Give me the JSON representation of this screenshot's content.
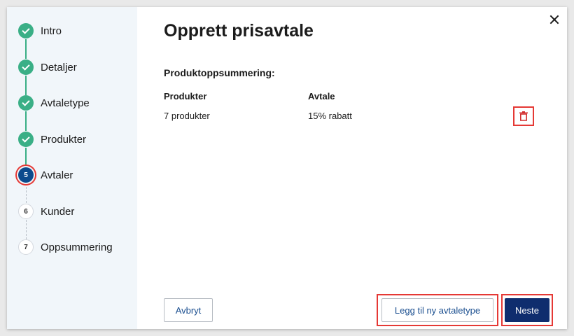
{
  "steps": [
    {
      "label": "Intro",
      "status": "done"
    },
    {
      "label": "Detaljer",
      "status": "done"
    },
    {
      "label": "Avtaletype",
      "status": "done"
    },
    {
      "label": "Produkter",
      "status": "done"
    },
    {
      "label": "Avtaler",
      "status": "active",
      "number": "5"
    },
    {
      "label": "Kunder",
      "status": "todo",
      "number": "6"
    },
    {
      "label": "Oppsummering",
      "status": "todo",
      "number": "7"
    }
  ],
  "dialog": {
    "title": "Opprett prisavtale",
    "section_title": "Produktoppsummering:",
    "table": {
      "headers": [
        "Produkter",
        "Avtale"
      ],
      "rows": [
        [
          "7 produkter",
          "15% rabatt"
        ]
      ]
    },
    "close_icon": "close-icon",
    "delete_icon": "trash-icon"
  },
  "footer": {
    "cancel_label": "Avbryt",
    "add_label": "Legg til ny avtaletype",
    "next_label": "Neste"
  },
  "colors": {
    "done": "#3aaf86",
    "active": "#0b4a8d",
    "primary_button": "#0f2d6e",
    "highlight": "#e53935"
  }
}
